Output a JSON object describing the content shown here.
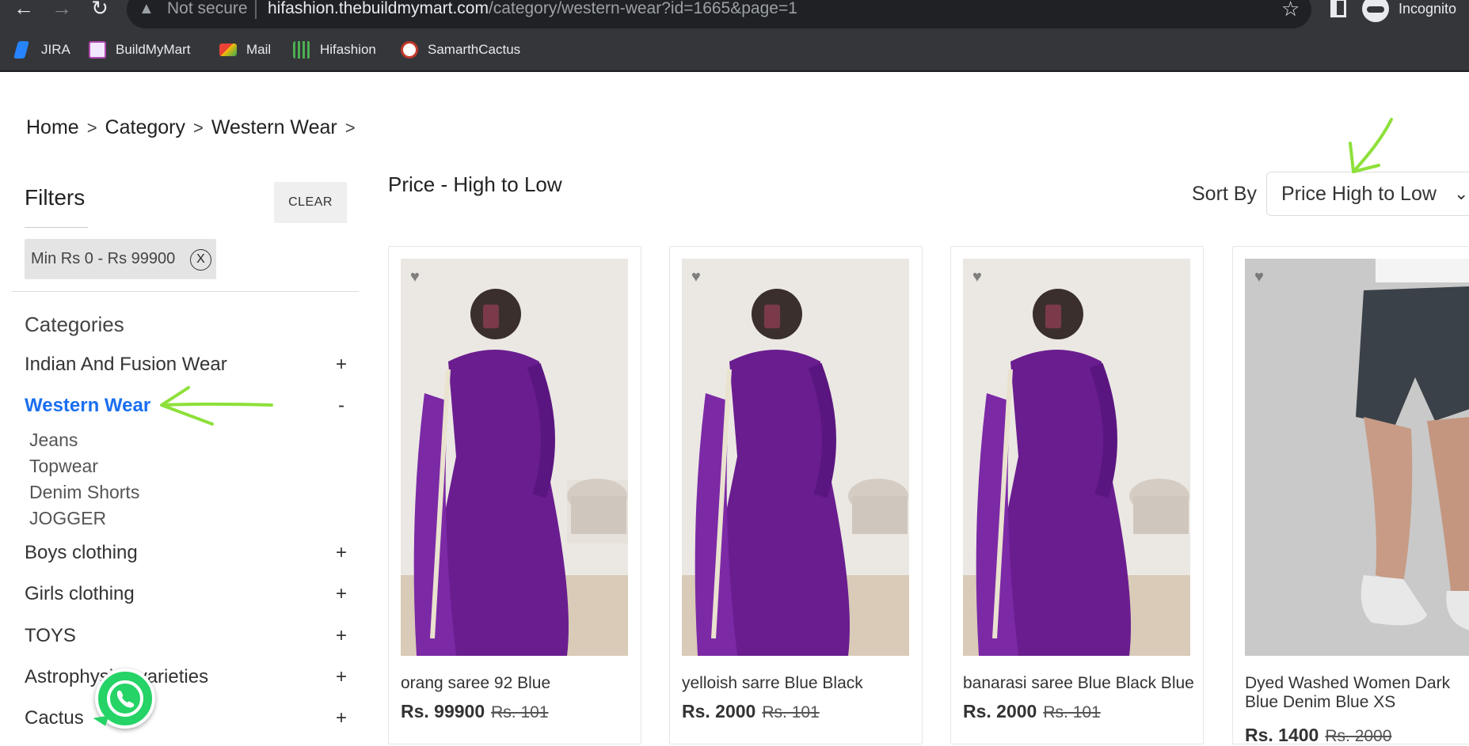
{
  "browser": {
    "security_text": "Not secure",
    "url_host": "hifashion.thebuildmymart.com",
    "url_path": "/category/western-wear?id=1665&page=1",
    "profile_label": "Incognito",
    "bookmarks": [
      {
        "label": "JIRA",
        "icon": "jira-icon",
        "color": "#2684ff"
      },
      {
        "label": "BuildMyMart",
        "icon": "buildmymart-icon",
        "color": "#f3e7ff"
      },
      {
        "label": "Mail",
        "icon": "gmail-icon",
        "color": "#ea4335"
      },
      {
        "label": "Hifashion",
        "icon": "hifashion-icon",
        "color": "#4caf50"
      },
      {
        "label": "SamarthCactus",
        "icon": "cactus-icon",
        "color": "#ffffff"
      }
    ]
  },
  "breadcrumb": [
    "Home",
    "Category",
    "Western Wear"
  ],
  "filters": {
    "title": "Filters",
    "clear_label": "CLEAR",
    "price_chip": "Min Rs 0 - Rs 99900",
    "chip_close": "X"
  },
  "categories": {
    "title": "Categories",
    "items": [
      {
        "label": "Indian And Fusion Wear",
        "toggle": "+"
      },
      {
        "label": "Western Wear",
        "toggle": "-",
        "active": true,
        "children": [
          "Jeans",
          "Topwear",
          "Denim Shorts",
          "JOGGER"
        ]
      },
      {
        "label": "Boys clothing",
        "toggle": "+"
      },
      {
        "label": "Girls clothing",
        "toggle": "+"
      },
      {
        "label": "TOYS",
        "toggle": "+"
      },
      {
        "label": "Astrophysics varieties",
        "toggle": "+"
      },
      {
        "label": "Cactus",
        "toggle": "+"
      }
    ]
  },
  "sort": {
    "heading": "Price - High to Low",
    "label": "Sort By",
    "selected": "Price High to Low"
  },
  "products": [
    {
      "title": "orang saree 92 Blue",
      "price": "Rs. 99900",
      "mrp": "Rs. 101"
    },
    {
      "title": "yelloish sarre Blue Black",
      "price": "Rs. 2000",
      "mrp": "Rs. 101"
    },
    {
      "title": "banarasi saree Blue Black Blue",
      "price": "Rs. 2000",
      "mrp": "Rs. 101"
    },
    {
      "title": "Dyed Washed Women Dark Blue Denim Blue XS",
      "price": "Rs. 1400",
      "mrp": "Rs. 2000"
    }
  ],
  "colors": {
    "accent_blue": "#1a6ff0",
    "annotation_green": "#8ee03a",
    "whatsapp_green": "#25d366"
  }
}
